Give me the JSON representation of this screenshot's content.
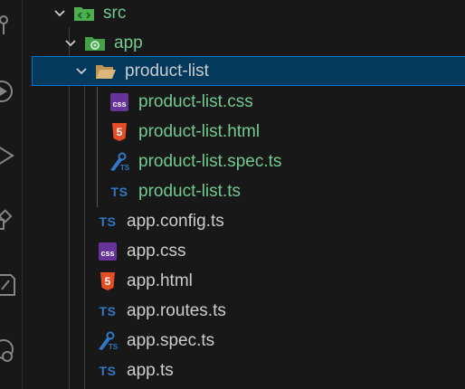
{
  "explorer": {
    "items": [
      {
        "label": "src",
        "icon": "src-folder-icon",
        "kind": "folder"
      },
      {
        "label": "app",
        "icon": "app-folder-icon",
        "kind": "folder"
      },
      {
        "label": "product-list",
        "icon": "folder-open-icon",
        "kind": "folder",
        "selected": true
      },
      {
        "label": "product-list.css",
        "icon": "css-file-icon",
        "kind": "file"
      },
      {
        "label": "product-list.html",
        "icon": "html-file-icon",
        "kind": "file"
      },
      {
        "label": "product-list.spec.ts",
        "icon": "spec-file-icon",
        "kind": "file"
      },
      {
        "label": "product-list.ts",
        "icon": "ts-file-icon",
        "kind": "file"
      },
      {
        "label": "app.config.ts",
        "icon": "ts-file-icon",
        "kind": "file"
      },
      {
        "label": "app.css",
        "icon": "css-file-icon",
        "kind": "file"
      },
      {
        "label": "app.html",
        "icon": "html-file-icon",
        "kind": "file"
      },
      {
        "label": "app.routes.ts",
        "icon": "ts-file-icon",
        "kind": "file"
      },
      {
        "label": "app.spec.ts",
        "icon": "spec-file-icon",
        "kind": "file"
      },
      {
        "label": "app.ts",
        "icon": "ts-file-icon",
        "kind": "file"
      }
    ],
    "ts_glyph": "TS",
    "css_glyph": "css",
    "html_glyph": "5"
  },
  "activity_bar": {
    "icons": [
      "source-control-icon",
      "run-debug-icon",
      "run-icon",
      "extensions-icon",
      "testing-icon",
      "remote-icon"
    ]
  },
  "colors": {
    "background": "#181818",
    "selected_bg": "#04395e",
    "selected_border": "#0078d4",
    "modified_text": "#73c991",
    "default_text": "#cccccc",
    "ts_blue": "#3178c6",
    "css_purple": "#663399",
    "html_orange": "#e44d26"
  }
}
